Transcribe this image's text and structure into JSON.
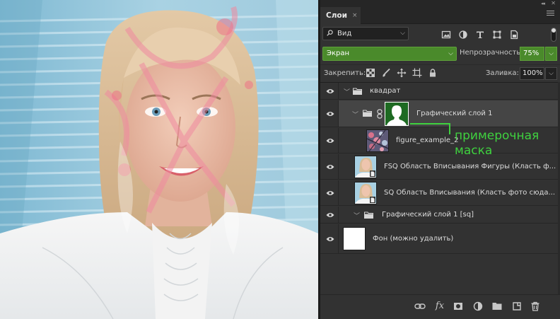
{
  "panel": {
    "tab_label": "Слои",
    "tab_close": "×",
    "collapse_glyph": "◂◂",
    "close_glyph": "✕"
  },
  "filter": {
    "label": "Вид",
    "chevron": "⌵",
    "icons": [
      "image-filter-icon",
      "adjustment-filter-icon",
      "type-filter-icon",
      "shape-filter-icon",
      "smart-object-filter-icon"
    ]
  },
  "blend": {
    "mode": "Экран",
    "opacity_label": "Непрозрачность:",
    "opacity_value": "75%",
    "chevron": "⌵",
    "accent_color": "#4a8a2b"
  },
  "lock": {
    "label": "Закрепить:",
    "fill_label": "Заливка:",
    "fill_value": "100%"
  },
  "layers": [
    {
      "name": "квадрат",
      "type": "group",
      "expanded": true,
      "visible": true
    },
    {
      "name": "Графический слой 1",
      "type": "group-with-mask",
      "expanded": true,
      "visible": true,
      "selected": true
    },
    {
      "name": "figure_example_2",
      "type": "image",
      "visible": true
    },
    {
      "name": "FSQ Область Вписывания Фигуры (Класть ф...",
      "type": "smart-object",
      "visible": true
    },
    {
      "name": "SQ Область Вписывания (Класть фото сюда...",
      "type": "smart-object",
      "visible": true
    },
    {
      "name": "Графический слой 1 [sq]",
      "type": "group",
      "expanded": false,
      "visible": true
    },
    {
      "name": "Фон (можно удалить)",
      "type": "background",
      "visible": true
    }
  ],
  "annotation": {
    "text": "примерочная\nмаска",
    "color": "#3fd13f"
  },
  "bottom_toolbar": {
    "fx_label": "fx",
    "icons": [
      "link-layers-icon",
      "fx-icon",
      "add-mask-icon",
      "adjustment-layer-icon",
      "new-group-icon",
      "new-layer-icon",
      "delete-layer-icon"
    ]
  }
}
